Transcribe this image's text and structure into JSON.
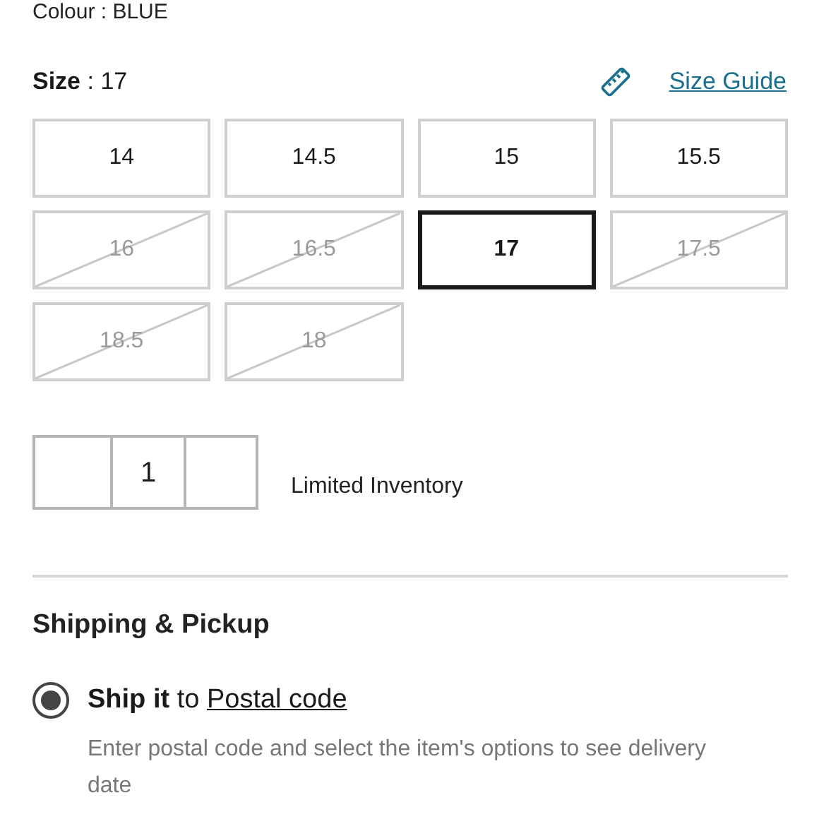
{
  "colour": {
    "text": "Colour : BLUE"
  },
  "size": {
    "text": "**Size** : 17"
  },
  "size_guide": {
    "label": "Size Guide"
  },
  "sizes": [
    {
      "label": "14",
      "available": true,
      "selected": false
    },
    {
      "label": "14.5",
      "available": true,
      "selected": false
    },
    {
      "label": "15",
      "available": true,
      "selected": false
    },
    {
      "label": "15.5",
      "available": true,
      "selected": false
    },
    {
      "label": "16",
      "available": false,
      "selected": false
    },
    {
      "label": "16.5",
      "available": false,
      "selected": false
    },
    {
      "label": "17",
      "available": true,
      "selected": true
    },
    {
      "label": "17.5",
      "available": false,
      "selected": false
    },
    {
      "label": "18.5",
      "available": false,
      "selected": false
    },
    {
      "label": "18",
      "available": false,
      "selected": false
    }
  ],
  "quantity": {
    "value": "1",
    "note": "Limited Inventory"
  },
  "shipping": {
    "title": "Shipping & Pickup",
    "options": [
      {
        "text": "**Ship it** to",
        "link": "Postal code",
        "selected": true,
        "description": "Enter postal code and select the item's options to see delivery date"
      }
    ]
  }
}
